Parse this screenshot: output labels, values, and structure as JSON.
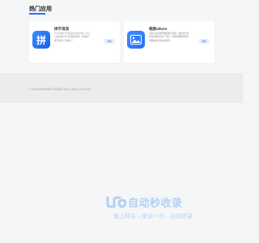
{
  "section": {
    "title": "热门应用"
  },
  "apps": [
    {
      "name": "拼字消消",
      "description": "可以让用户学习拼音记忆的方法，可让儿童和用户学习也能的游戏，在领域人群已经处于等特色了",
      "button_label": "详情",
      "icon_glyph": "拼",
      "icon": "pinyin-app-icon"
    },
    {
      "name": "相册album",
      "description": "当前打造高效的数据整合系统，确立交付流程和高效性目标广泛性，智能化图像管理计划数据用户我在这样的",
      "button_label": "详情",
      "icon": "photo-album-icon"
    }
  ],
  "footer": {
    "copyright": "广州星荣信息技术有限公司 版权所有 备xxxxx 版权 Copyright 2023"
  },
  "watermark": {
    "title": "自动秒收录",
    "subtitle": "做上排名→来访一次→自动收录",
    "logo": "link-logo"
  },
  "colors": {
    "accent": "#2f6bff",
    "footer_bg": "#ececef",
    "watermark": "#3b8de0"
  }
}
